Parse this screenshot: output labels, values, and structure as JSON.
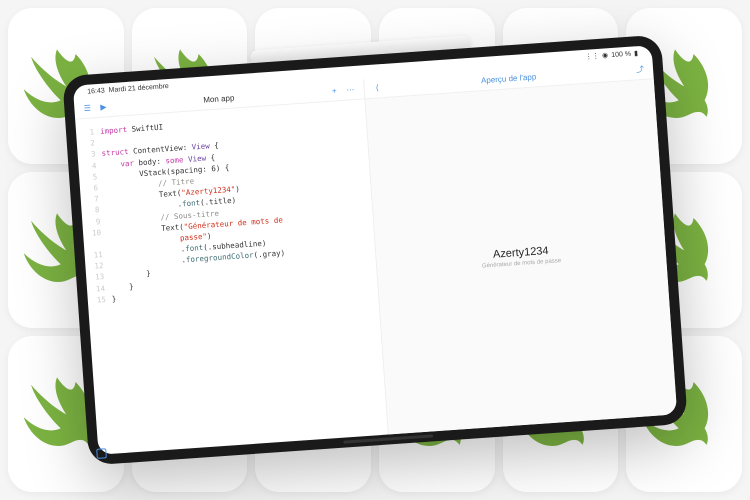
{
  "status": {
    "time": "16:43",
    "date": "Mardi 21 décembre",
    "battery": "100 %"
  },
  "editor": {
    "title": "Mon app",
    "lines": [
      {
        "n": "1",
        "seg": [
          [
            "kw",
            "import"
          ],
          [
            "",
            " SwiftUI"
          ]
        ]
      },
      {
        "n": "2",
        "seg": []
      },
      {
        "n": "3",
        "seg": [
          [
            "kw",
            "struct"
          ],
          [
            "",
            " ContentView: "
          ],
          [
            "ty",
            "View"
          ],
          [
            "",
            " {"
          ]
        ]
      },
      {
        "n": "4",
        "seg": [
          [
            "",
            "    "
          ],
          [
            "kw",
            "var"
          ],
          [
            "",
            " body: "
          ],
          [
            "kw",
            "some"
          ],
          [
            "",
            " "
          ],
          [
            "ty",
            "View"
          ],
          [
            "",
            " {"
          ]
        ]
      },
      {
        "n": "5",
        "seg": [
          [
            "",
            "        VStack(spacing: 6) {"
          ]
        ]
      },
      {
        "n": "6",
        "seg": [
          [
            "",
            "            "
          ],
          [
            "cm",
            "// Titre"
          ]
        ]
      },
      {
        "n": "7",
        "seg": [
          [
            "",
            "            Text("
          ],
          [
            "str",
            "\"Azerty1234\""
          ],
          [
            "",
            ")"
          ]
        ]
      },
      {
        "n": "8",
        "seg": [
          [
            "",
            "                ."
          ],
          [
            "mem",
            "font"
          ],
          [
            "",
            "(.title)"
          ]
        ]
      },
      {
        "n": "9",
        "seg": [
          [
            "",
            "            "
          ],
          [
            "cm",
            "// Sous-titre"
          ]
        ]
      },
      {
        "n": "10",
        "seg": [
          [
            "",
            "            Text("
          ],
          [
            "str",
            "\"Générateur de mots de"
          ]
        ]
      },
      {
        "n": "",
        "seg": [
          [
            "",
            "                "
          ],
          [
            "str",
            "passe\""
          ],
          [
            "",
            ")"
          ]
        ]
      },
      {
        "n": "11",
        "seg": [
          [
            "",
            "                ."
          ],
          [
            "mem",
            "font"
          ],
          [
            "",
            "(.subheadline)"
          ]
        ]
      },
      {
        "n": "12",
        "seg": [
          [
            "",
            "                ."
          ],
          [
            "mem",
            "foregroundColor"
          ],
          [
            "",
            "(.gray)"
          ]
        ]
      },
      {
        "n": "13",
        "seg": [
          [
            "",
            "        }"
          ]
        ]
      },
      {
        "n": "14",
        "seg": [
          [
            "",
            "    }"
          ]
        ]
      },
      {
        "n": "15",
        "seg": [
          [
            "",
            "}"
          ]
        ]
      }
    ]
  },
  "preview": {
    "title": "Aperçu de l'app",
    "main": "Azerty1234",
    "sub": "Générateur de mots de passe"
  }
}
